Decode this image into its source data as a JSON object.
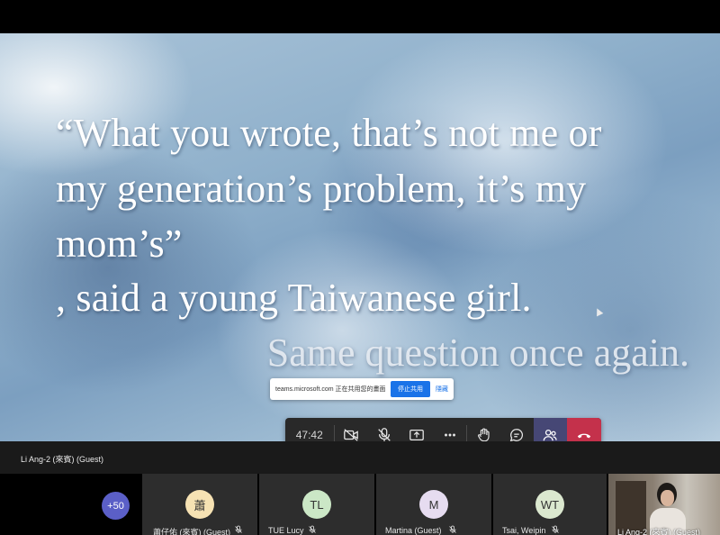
{
  "slide": {
    "quote_lines": [
      "“What you wrote, that’s not me or",
      "my generation’s problem, it’s my",
      "mom’s”",
      ", said a young Taiwanese girl."
    ],
    "subline": "Same question once again."
  },
  "share_banner": {
    "message": "teams.microsoft.com 正在共用您的畫面。",
    "stop_label": "停止共用",
    "hide_label": "隱藏"
  },
  "controls": {
    "timer": "47:42",
    "icons": [
      "camera-off-icon",
      "mic-off-icon",
      "share-screen-icon",
      "more-icon",
      "raise-hand-icon",
      "chat-icon",
      "people-icon",
      "hang-up-icon"
    ]
  },
  "presenter": {
    "name": "Li Ang-2 (來賓) (Guest)"
  },
  "participants": {
    "overflow_count": "+50",
    "tiles": [
      {
        "initials": "蕭",
        "name": "蕭仔佑 (來賓) (Guest)",
        "avatar_color": "#f6e2b3"
      },
      {
        "initials": "TL",
        "name": "TUE Lucy",
        "avatar_color": "#cbe7c6"
      },
      {
        "initials": "M",
        "name": "Martina (Guest)",
        "avatar_color": "#e6dcf0"
      },
      {
        "initials": "WT",
        "name": "Tsai, Weipin",
        "avatar_color": "#dbe8cf"
      }
    ],
    "video_tile_name": "Li Ang-2 (來賓) (Guest)"
  },
  "colors": {
    "toolbar_bg": "#292929",
    "people_active": "#464775",
    "hangup": "#c4314b",
    "overflow_badge": "#5b5fc7",
    "banner_button": "#1a73e8"
  }
}
